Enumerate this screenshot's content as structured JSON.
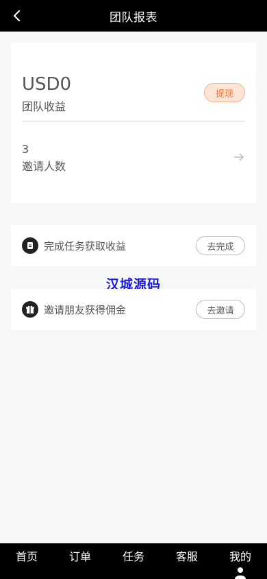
{
  "header": {
    "title": "团队报表"
  },
  "summary": {
    "amount": "USD0",
    "amount_label": "团队收益",
    "withdraw_label": "提现",
    "invite_count": "3",
    "invite_label": "邀请人数"
  },
  "tasks": [
    {
      "text": "完成任务获取收益",
      "button": "去完成",
      "icon": "document-icon"
    },
    {
      "text": "邀请朋友获得佣金",
      "button": "去邀请",
      "icon": "gift-icon"
    }
  ],
  "watermark": "汉城源码",
  "tabbar": [
    {
      "label": "首页"
    },
    {
      "label": "订单"
    },
    {
      "label": "任务"
    },
    {
      "label": "客服"
    },
    {
      "label": "我的",
      "icon": "user-icon"
    }
  ]
}
